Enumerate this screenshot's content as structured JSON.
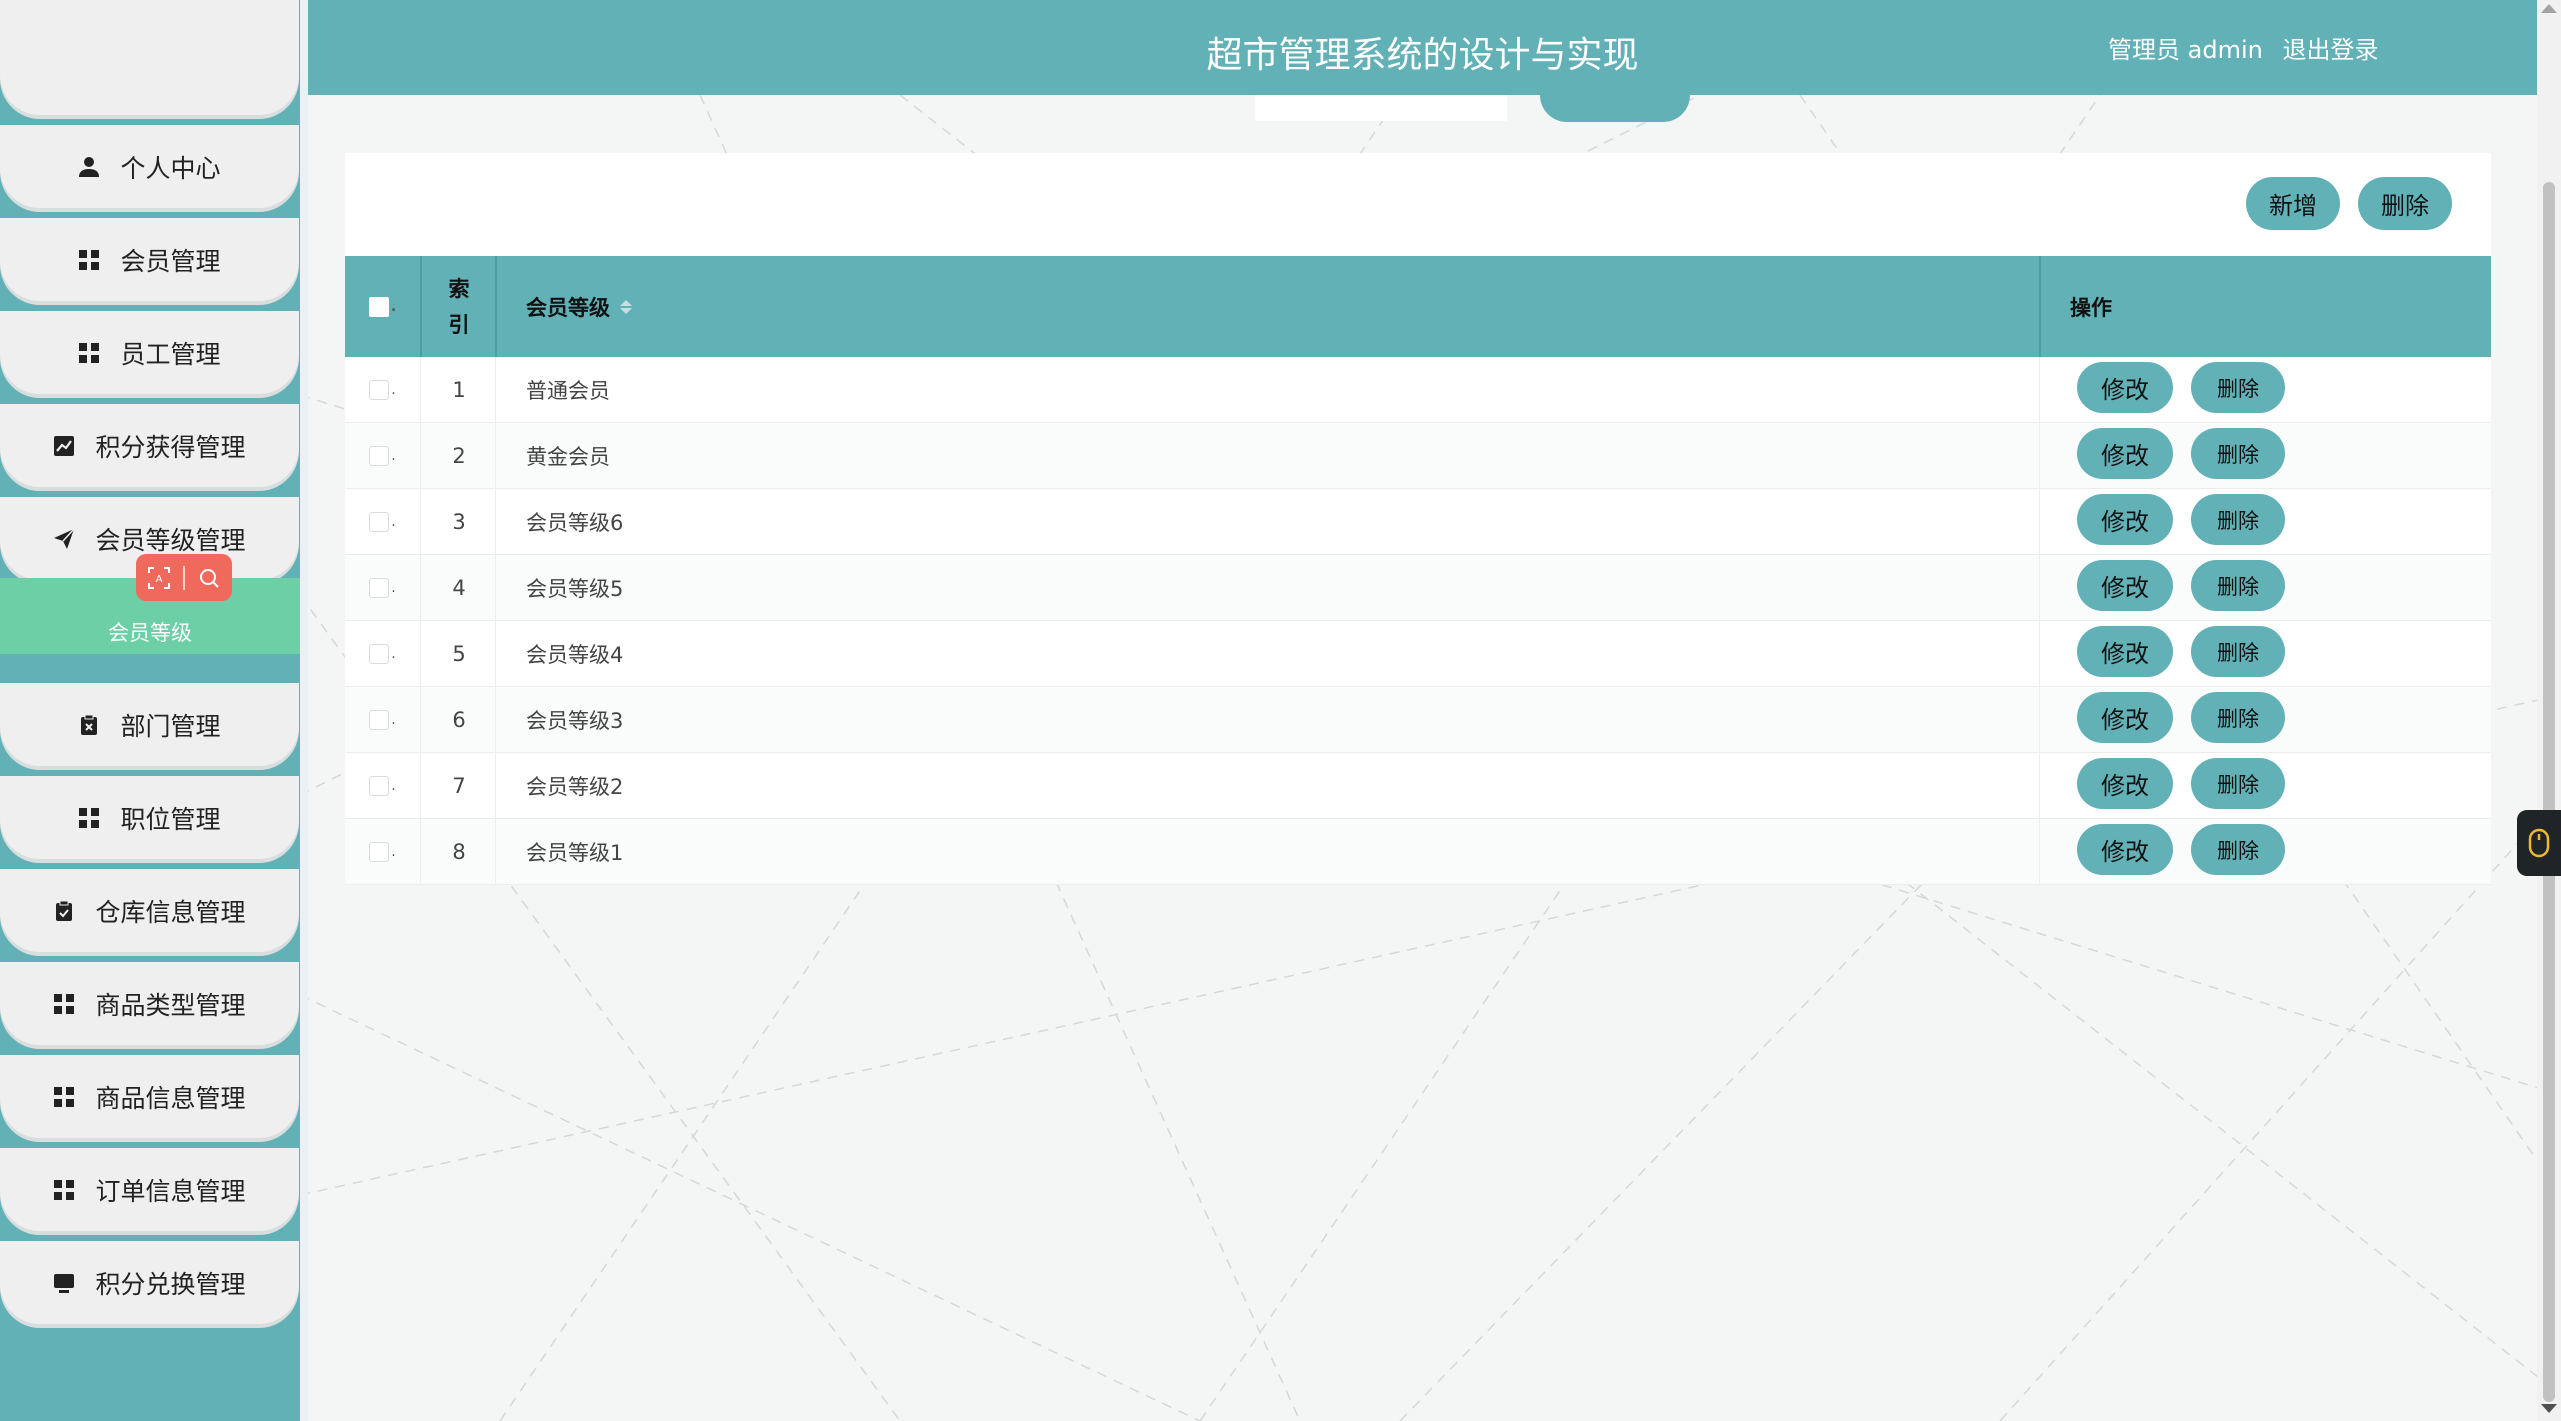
{
  "header": {
    "title": "超市管理系统的设计与实现",
    "user_label": "管理员 admin",
    "logout_label": "退出登录"
  },
  "sidebar": {
    "items": [
      {
        "label": "个人中心",
        "icon": "user-icon"
      },
      {
        "label": "会员管理",
        "icon": "grid-icon"
      },
      {
        "label": "员工管理",
        "icon": "grid-icon"
      },
      {
        "label": "积分获得管理",
        "icon": "chart-icon"
      },
      {
        "label": "会员等级管理",
        "icon": "send-icon"
      },
      {
        "label": "部门管理",
        "icon": "clipboard-x-icon"
      },
      {
        "label": "职位管理",
        "icon": "grid-icon"
      },
      {
        "label": "仓库信息管理",
        "icon": "clipboard-check-icon"
      },
      {
        "label": "商品类型管理",
        "icon": "grid-icon"
      },
      {
        "label": "商品信息管理",
        "icon": "grid-icon"
      },
      {
        "label": "订单信息管理",
        "icon": "grid-icon"
      },
      {
        "label": "积分兑换管理",
        "icon": "monitor-icon"
      }
    ],
    "active_submenu": "会员等级"
  },
  "toolbar": {
    "add_label": "新增",
    "delete_label": "删除"
  },
  "table": {
    "headers": {
      "index": "索引",
      "level": "会员等级",
      "actions": "操作"
    },
    "rows": [
      {
        "index": "1",
        "level": "普通会员"
      },
      {
        "index": "2",
        "level": "黄金会员"
      },
      {
        "index": "3",
        "level": "会员等级6"
      },
      {
        "index": "4",
        "level": "会员等级5"
      },
      {
        "index": "5",
        "level": "会员等级4"
      },
      {
        "index": "6",
        "level": "会员等级3"
      },
      {
        "index": "7",
        "level": "会员等级2"
      },
      {
        "index": "8",
        "level": "会员等级1"
      }
    ],
    "edit_label": "修改",
    "row_delete_label": "删除"
  },
  "colors": {
    "primary": "#62b1b7",
    "submenu_active": "#6ccfa6",
    "ai_tool": "#ef6a5d"
  }
}
